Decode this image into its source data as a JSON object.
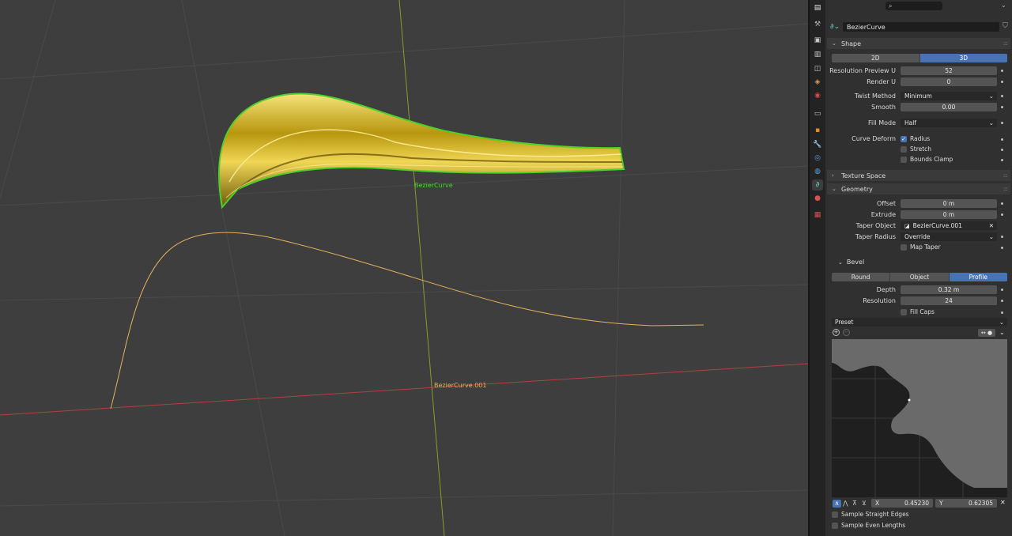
{
  "viewport": {
    "label_curve": "BezierCurve",
    "label_taper": "BezierCurve.001",
    "colors": {
      "selected": "#4bd12a",
      "taper": "#e6b25a",
      "gold": "#c9a51a",
      "x_axis": "#b33f3f",
      "y_axis": "#8c9a2c"
    }
  },
  "tabs": [
    "tool-icon",
    "render-icon",
    "output-icon",
    "view-layer-icon",
    "scene-icon",
    "world-icon",
    "collection-icon",
    "object-icon",
    "modifier-icon",
    "particles-icon",
    "physics-icon",
    "data-icon",
    "material-icon",
    "texture-icon"
  ],
  "header": {
    "search_placeholder": "",
    "datablock_name": "BezierCurve"
  },
  "shape": {
    "title": "Shape",
    "mode_2d": "2D",
    "mode_3d": "3D",
    "resolution_preview_u_label": "Resolution Preview U",
    "resolution_preview_u": "52",
    "render_u_label": "Render U",
    "render_u": "0",
    "twist_method_label": "Twist Method",
    "twist_method": "Minimum",
    "smooth_label": "Smooth",
    "smooth": "0.00",
    "fill_mode_label": "Fill Mode",
    "fill_mode": "Half",
    "curve_deform_label": "Curve Deform",
    "radius": "Radius",
    "stretch": "Stretch",
    "bounds_clamp": "Bounds Clamp"
  },
  "texture_space": {
    "title": "Texture Space"
  },
  "geometry": {
    "title": "Geometry",
    "offset_label": "Offset",
    "offset": "0 m",
    "extrude_label": "Extrude",
    "extrude": "0 m",
    "taper_object_label": "Taper Object",
    "taper_object": "BezierCurve.001",
    "taper_radius_label": "Taper Radius",
    "taper_radius": "Override",
    "map_taper": "Map Taper"
  },
  "bevel": {
    "title": "Bevel",
    "mode_round": "Round",
    "mode_object": "Object",
    "mode_profile": "Profile",
    "depth_label": "Depth",
    "depth": "0.32 m",
    "resolution_label": "Resolution",
    "resolution": "24",
    "fill_caps": "Fill Caps",
    "preset_label": "Preset",
    "x_label": "X",
    "x_value": "0.45230",
    "y_label": "Y",
    "y_value": "0.62305",
    "sample_straight_edges": "Sample Straight Edges",
    "sample_even_lengths": "Sample Even Lengths"
  }
}
